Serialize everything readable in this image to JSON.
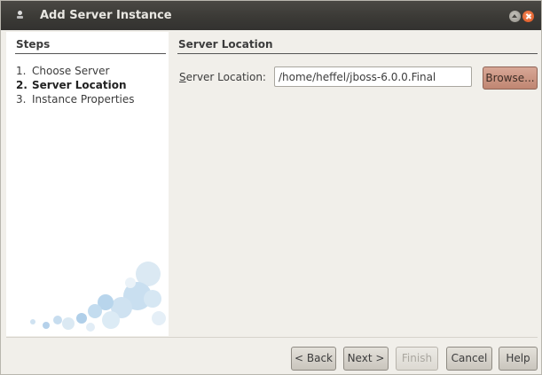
{
  "window": {
    "title": "Add Server Instance"
  },
  "steps": {
    "header": "Steps",
    "items": [
      {
        "num": "1.",
        "label": "Choose Server",
        "current": false
      },
      {
        "num": "2.",
        "label": "Server Location",
        "current": true
      },
      {
        "num": "3.",
        "label": "Instance Properties",
        "current": false
      }
    ]
  },
  "main": {
    "header": "Server Location",
    "location_label_prefix": "S",
    "location_label_rest": "erver Location:",
    "location_value": "/home/heffel/jboss-6.0.0.Final",
    "browse_prefix": "Browse",
    "browse_suffix": "..."
  },
  "buttons": {
    "back": "< Back",
    "next": "Next >",
    "finish": "Finish",
    "cancel": "Cancel",
    "help": "Help"
  },
  "colors": {
    "browse_accent": "#c89482",
    "titlebar": "#3c3b37",
    "close": "#df5a24"
  }
}
